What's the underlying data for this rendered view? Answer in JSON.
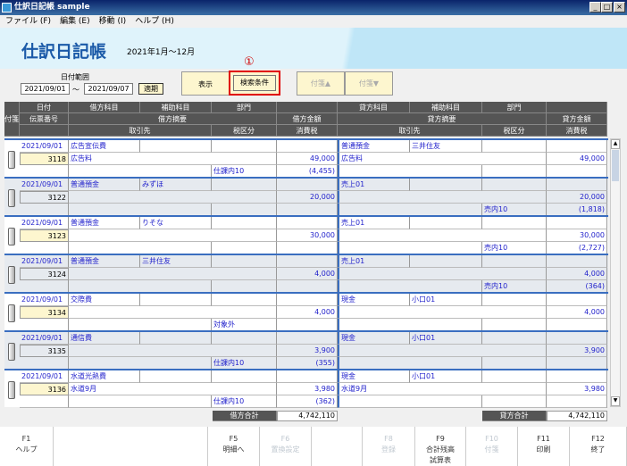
{
  "window": {
    "title": "仕訳日記帳 sample",
    "controls": [
      "_",
      "□",
      "×"
    ]
  },
  "menu": [
    "ファイル (F)",
    "編集 (E)",
    "移動 (I)",
    "ヘルプ (H)"
  ],
  "banner": {
    "title": "仕訳日記帳",
    "period": "2021年1月～12月"
  },
  "filter": {
    "date_range_label": "日付範囲",
    "from": "2021/09/01",
    "tilde": "～",
    "to": "2021/09/07",
    "apply": "適期"
  },
  "buttons": {
    "display": "表示",
    "search": "検索条件",
    "marker": "①",
    "tag_up": "付箋▲",
    "tag_down": "付箋▼"
  },
  "header": {
    "tag": "付箋",
    "date": "日付",
    "slip_no": "伝票番号",
    "debit_account": "借方科目",
    "debit_sub": "補助科目",
    "debit_dept": "部門",
    "debit_summary": "借方摘要",
    "debit_amount": "借方金額",
    "partner": "取引先",
    "tax_class": "税区分",
    "tax": "消費税",
    "credit_account": "貸方科目",
    "credit_sub": "補助科目",
    "credit_dept": "部門",
    "credit_summary": "貸方摘要",
    "credit_amount": "貸方金額",
    "credit_partner": "取引先",
    "credit_tax_class": "税区分",
    "credit_tax": "消費税"
  },
  "entries": [
    {
      "date": "2021/09/01",
      "slip": "3118",
      "slip_highlight": true,
      "d_acc": "広告宣伝費",
      "d_sub": "",
      "d_sum": "広告料",
      "d_amt": "49,000",
      "d_tc": "仕課内10",
      "d_tax": "(4,455)",
      "c_acc": "普通預金",
      "c_sub": "三井住友",
      "c_sum": "広告料",
      "c_amt": "49,000",
      "c_tc": "",
      "c_tax": ""
    },
    {
      "date": "2021/09/01",
      "slip": "3122",
      "slip_highlight": false,
      "d_acc": "普通預金",
      "d_sub": "みずほ",
      "d_sum": "",
      "d_amt": "20,000",
      "d_tc": "",
      "d_tax": "",
      "c_acc": "売上01",
      "c_sub": "",
      "c_sum": "",
      "c_amt": "20,000",
      "c_tc": "売内10",
      "c_tax": "(1,818)"
    },
    {
      "date": "2021/09/01",
      "slip": "3123",
      "slip_highlight": true,
      "d_acc": "普通預金",
      "d_sub": "りそな",
      "d_sum": "",
      "d_amt": "30,000",
      "d_tc": "",
      "d_tax": "",
      "c_acc": "売上01",
      "c_sub": "",
      "c_sum": "",
      "c_amt": "30,000",
      "c_tc": "売内10",
      "c_tax": "(2,727)"
    },
    {
      "date": "2021/09/01",
      "slip": "3124",
      "slip_highlight": false,
      "d_acc": "普通預金",
      "d_sub": "三井住友",
      "d_sum": "",
      "d_amt": "4,000",
      "d_tc": "",
      "d_tax": "",
      "c_acc": "売上01",
      "c_sub": "",
      "c_sum": "",
      "c_amt": "4,000",
      "c_tc": "売内10",
      "c_tax": "(364)"
    },
    {
      "date": "2021/09/01",
      "slip": "3134",
      "slip_highlight": true,
      "d_acc": "交際費",
      "d_sub": "",
      "d_sum": "",
      "d_amt": "4,000",
      "d_tc": "対象外",
      "d_tax": "",
      "c_acc": "現金",
      "c_sub": "小口01",
      "c_sum": "",
      "c_amt": "4,000",
      "c_tc": "",
      "c_tax": ""
    },
    {
      "date": "2021/09/01",
      "slip": "3135",
      "slip_highlight": false,
      "d_acc": "通信費",
      "d_sub": "",
      "d_sum": "",
      "d_amt": "3,900",
      "d_tc": "仕課内10",
      "d_tax": "(355)",
      "c_acc": "現金",
      "c_sub": "小口01",
      "c_sum": "",
      "c_amt": "3,900",
      "c_tc": "",
      "c_tax": ""
    },
    {
      "date": "2021/09/01",
      "slip": "3136",
      "slip_highlight": true,
      "d_acc": "水道光熱費",
      "d_sub": "",
      "d_sum": "水道9月",
      "d_amt": "3,980",
      "d_tc": "仕課内10",
      "d_tax": "(362)",
      "c_acc": "現金",
      "c_sub": "小口01",
      "c_sum": "水道9月",
      "c_amt": "3,980",
      "c_tc": "",
      "c_tax": ""
    }
  ],
  "totals": {
    "debit_label": "借方合計",
    "debit": "4,742,110",
    "credit_label": "貸方合計",
    "credit": "4,742,110"
  },
  "fkeys": [
    {
      "key": "F1",
      "label": "ヘルプ",
      "enabled": true
    },
    {
      "key": "",
      "label": "",
      "enabled": false
    },
    {
      "key": "F5",
      "label": "明細へ",
      "enabled": true
    },
    {
      "key": "F6",
      "label": "置換設定",
      "enabled": false
    },
    {
      "key": "",
      "label": "",
      "enabled": false
    },
    {
      "key": "F8",
      "label": "登録",
      "enabled": false
    },
    {
      "key": "F9",
      "label": "合計残高\n試算表",
      "enabled": true
    },
    {
      "key": "F10",
      "label": "付箋",
      "enabled": false
    },
    {
      "key": "F11",
      "label": "印刷",
      "enabled": true
    },
    {
      "key": "F12",
      "label": "終了",
      "enabled": true
    }
  ]
}
